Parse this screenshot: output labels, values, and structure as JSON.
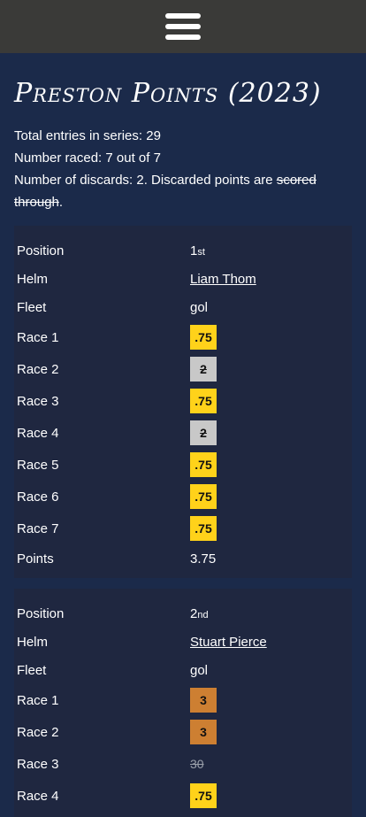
{
  "header": {
    "menu_icon": "hamburger-icon"
  },
  "title": "Preston Points (2023)",
  "summary": {
    "entries": "Total entries in series: 29",
    "raced": "Number raced: 7 out of 7",
    "discards_prefix": "Number of discards: 2. Discarded points are ",
    "discards_struck": "scored through",
    "discards_suffix": "."
  },
  "labels": {
    "position": "Position",
    "helm": "Helm",
    "fleet": "Fleet",
    "points": "Points",
    "race1": "Race 1",
    "race2": "Race 2",
    "race3": "Race 3",
    "race4": "Race 4",
    "race5": "Race 5",
    "race6": "Race 6",
    "race7": "Race 7"
  },
  "entries": [
    {
      "position_num": "1",
      "position_suffix": "st",
      "helm": "Liam Thom",
      "fleet": "gol",
      "races": [
        ".75",
        "2",
        ".75",
        "2",
        ".75",
        ".75",
        ".75"
      ],
      "points": "3.75"
    },
    {
      "position_num": "2",
      "position_suffix": "nd",
      "helm": "Stuart Pierce",
      "fleet": "gol",
      "races": [
        "3",
        "3",
        "30",
        ".75"
      ]
    }
  ],
  "colors": {
    "gold": "#ffd21a",
    "silver": "#c8c8c8",
    "bronze": "#cd7f32",
    "background": "#1b2a4a"
  }
}
